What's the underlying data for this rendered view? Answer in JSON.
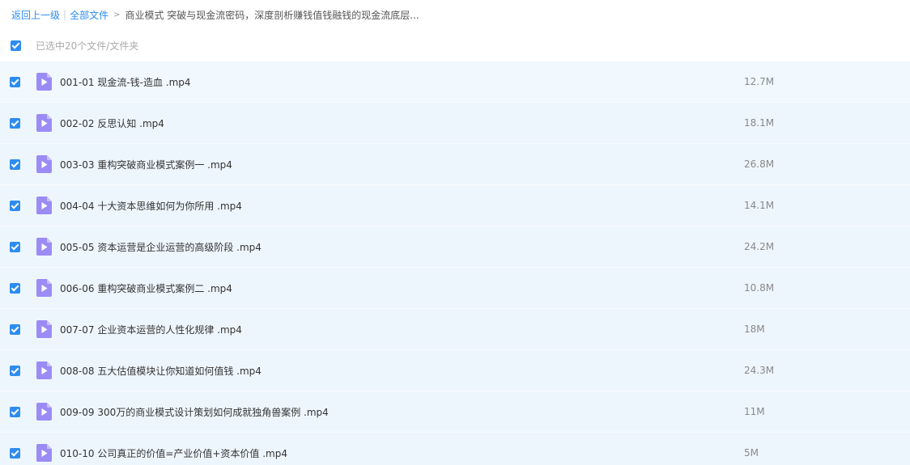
{
  "breadcrumb": {
    "back_label": "返回上一级",
    "separator": "|",
    "all_files_label": "全部文件",
    "arrow": ">",
    "current_folder": "商业模式 突破与现金流密码，深度剖析赚钱值钱融钱的现金流底层..."
  },
  "selection": {
    "label": "已选中20个文件/文件夹"
  },
  "files": [
    {
      "name": "001-01 现金流-钱-造血 .mp4",
      "size": "12.7M"
    },
    {
      "name": "002-02 反思认知 .mp4",
      "size": "18.1M"
    },
    {
      "name": "003-03 重构突破商业模式案例一 .mp4",
      "size": "26.8M"
    },
    {
      "name": "004-04 十大资本思维如何为你所用 .mp4",
      "size": "14.1M"
    },
    {
      "name": "005-05 资本运营是企业运营的高级阶段 .mp4",
      "size": "24.2M"
    },
    {
      "name": "006-06 重构突破商业模式案例二 .mp4",
      "size": "10.8M"
    },
    {
      "name": "007-07 企业资本运营的人性化规律 .mp4",
      "size": "18M"
    },
    {
      "name": "008-08 五大估值模块让你知道如何值钱 .mp4",
      "size": "24.3M"
    },
    {
      "name": "009-09 300万的商业模式设计策划如何成就独角兽案例 .mp4",
      "size": "11M"
    },
    {
      "name": "010-10 公司真正的价值=产业价值+资本价值 .mp4",
      "size": "5M"
    }
  ],
  "colors": {
    "accent": "#2d8cf0",
    "row_background": "#eef6fd",
    "video_icon": "#9b8cf5"
  }
}
